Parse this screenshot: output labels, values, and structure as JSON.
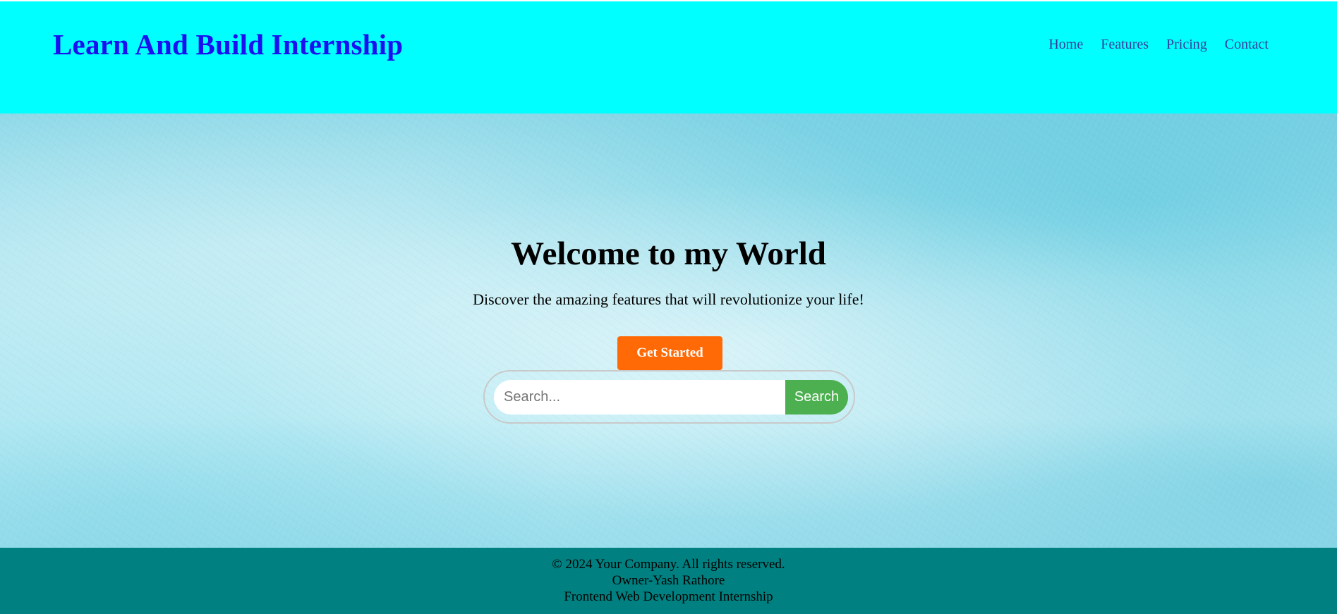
{
  "header": {
    "brand": "Learn And Build Internship",
    "nav": [
      "Home",
      "Features",
      "Pricing",
      "Contact"
    ]
  },
  "hero": {
    "title": "Welcome to my World",
    "subtitle": "Discover the amazing features that will revolutionize your life!",
    "cta_label": "Get Started",
    "search": {
      "placeholder": "Search...",
      "button_label": "Search"
    }
  },
  "footer": {
    "copyright": "© 2024 Your Company. All rights reserved.",
    "owner": "Owner-Yash Rathore",
    "program": "Frontend Web Development Internship"
  },
  "colors": {
    "header_bg": "#00ffff",
    "brand": "#1a10f0",
    "cta_bg": "#ff6a06",
    "search_button_bg": "#4caf50",
    "footer_bg": "#008080"
  }
}
